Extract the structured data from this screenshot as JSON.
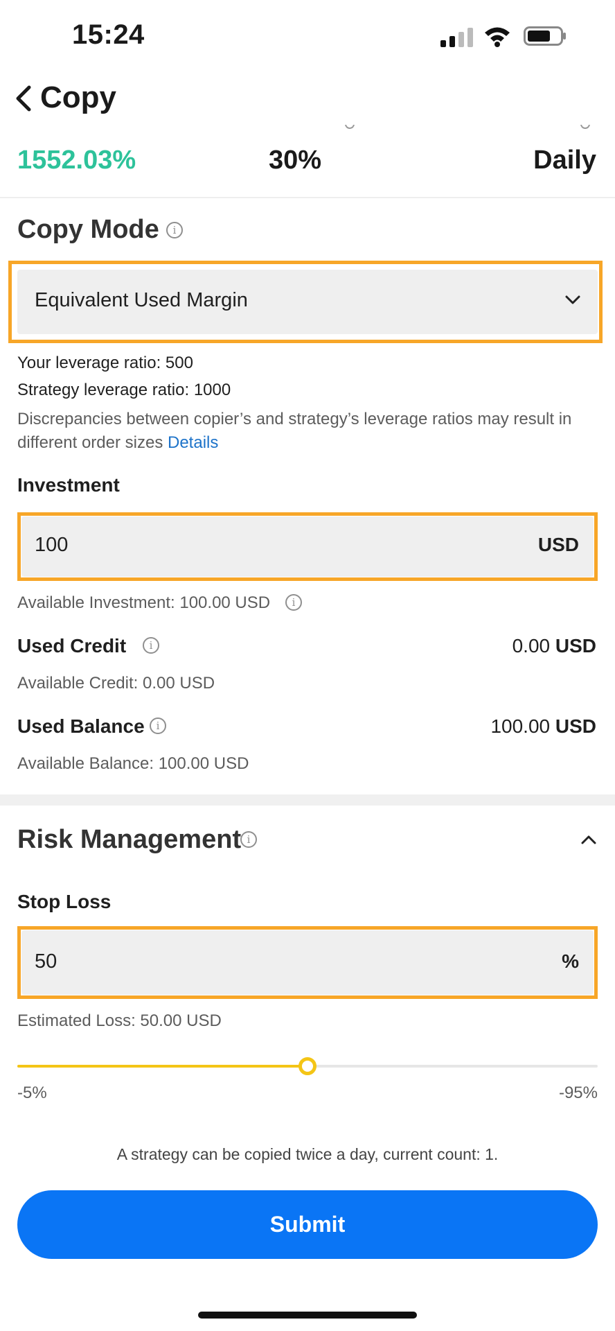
{
  "status_bar": {
    "time": "15:24"
  },
  "nav": {
    "title": "Copy"
  },
  "stats": {
    "profit": "1552.03%",
    "middle": "30%",
    "frequency": "Daily"
  },
  "copy_mode": {
    "title": "Copy Mode",
    "selected": "Equivalent Used Margin",
    "your_leverage_label": "Your leverage ratio:",
    "your_leverage_value": "500",
    "strategy_leverage_label": "Strategy leverage ratio:",
    "strategy_leverage_value": "1000",
    "discrepancy_line1": "Discrepancies between copier’s and strategy’s leverage ratios may result in",
    "discrepancy_line2": "different order sizes",
    "details_link": "Details"
  },
  "investment": {
    "title": "Investment",
    "value": "100",
    "unit": "USD",
    "available": "Available Investment: 100.00 USD"
  },
  "used_credit": {
    "label": "Used Credit",
    "amount": "0.00",
    "unit": "USD",
    "available": "Available Credit: 0.00 USD"
  },
  "used_balance": {
    "label": "Used Balance",
    "amount": "100.00",
    "unit": "USD",
    "available": "Available Balance: 100.00 USD"
  },
  "risk": {
    "title": "Risk Management",
    "stop_loss_label": "Stop Loss",
    "stop_loss_value": "50",
    "stop_loss_unit": "%",
    "estimated_loss": "Estimated Loss: 50.00 USD",
    "slider_min_label": "-5%",
    "slider_max_label": "-95%",
    "slider_fraction": 0.5
  },
  "notice": "A strategy can be copied twice a day, current count: 1.",
  "submit_label": "Submit",
  "colors": {
    "accent_green": "#2dc29a",
    "highlight_orange": "#f7a628",
    "slider_yellow": "#f4c516",
    "link_blue": "#1d73c9",
    "submit_blue": "#0a75f5"
  }
}
